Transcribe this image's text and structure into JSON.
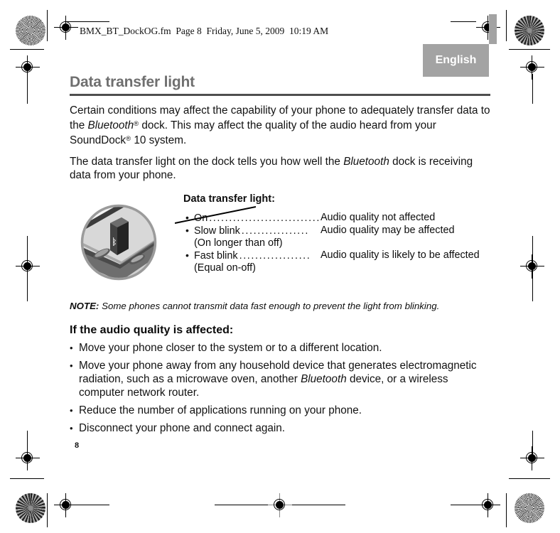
{
  "doc": {
    "header_line": "BMX_BT_DockOG.fm  Page 8  Friday, June 5, 2009  10:19 AM",
    "language_tab": "English",
    "page_number": "8"
  },
  "section": {
    "title": "Data transfer light",
    "paragraphs": [
      {
        "prefix": "Certain conditions may affect the capability of your phone to adequately transfer data to the ",
        "italic1": "Bluetooth",
        "reg1": "®",
        "middle": " dock. This may affect the quality of the audio heard from your SoundDock",
        "reg2": "®",
        "suffix": " 10 system."
      },
      {
        "prefix": "The data transfer light on the dock tells you how well the ",
        "italic1": "Bluetooth",
        "suffix": " dock is receiving data from your phone."
      }
    ]
  },
  "figure": {
    "callout_label": "Data transfer light:",
    "illustration_name": "bluetooth-dock-adapter-closeup",
    "rows": [
      {
        "bullet": "•",
        "state": "On",
        "leader": "............................",
        "sub": "",
        "result": "Audio quality not affected"
      },
      {
        "bullet": "•",
        "state": "Slow blink",
        "leader": ".................",
        "sub": "(On longer than off)",
        "result": "Audio quality may be affected"
      },
      {
        "bullet": "•",
        "state": "Fast blink",
        "leader": "..................",
        "sub": "(Equal on-off)",
        "result": "Audio quality is likely to be affected"
      }
    ]
  },
  "note": {
    "label": "NOTE:",
    "text": " Some phones cannot transmit data fast enough to prevent the light from blinking."
  },
  "remedies": {
    "heading": "If the audio quality is affected:",
    "items": [
      {
        "prefix": "Move your phone closer to the system or to a different location.",
        "italic1": "",
        "suffix": ""
      },
      {
        "prefix": "Move your phone away from any household device that generates electromagnetic radiation, such as a microwave oven, another ",
        "italic1": "Bluetooth",
        "suffix": " device, or a wireless computer network router."
      },
      {
        "prefix": "Reduce the number of applications running on your phone.",
        "italic1": "",
        "suffix": ""
      },
      {
        "prefix": "Disconnect your phone and connect again.",
        "italic1": "",
        "suffix": ""
      }
    ]
  },
  "colors": {
    "title_gray": "#6f6f6f",
    "rule_gray": "#4f4f4f",
    "tab_gray": "#a3a3a3",
    "text_black": "#121212"
  }
}
